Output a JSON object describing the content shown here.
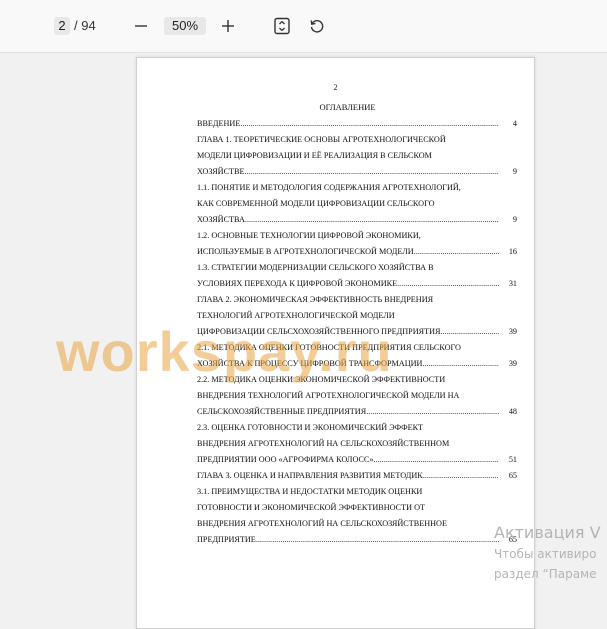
{
  "toolbar": {
    "current_page": "2",
    "total_pages": "/ 94",
    "zoom": "50%",
    "zoom_out_icon": "minus-icon",
    "zoom_in_icon": "plus-icon",
    "fit_icon": "fit-page-icon",
    "rotate_icon": "rotate-icon"
  },
  "document": {
    "page_number": "2",
    "toc_title": "ОГЛАВЛЕНИЕ",
    "toc": [
      {
        "lines": [],
        "last": "ВВЕДЕНИЕ",
        "page": "4"
      },
      {
        "lines": [
          "ГЛАВА 1. ТЕОРЕТИЧЕСКИЕ ОСНОВЫ АГРОТЕХНОЛОГИЧЕСКОЙ",
          "МОДЕЛИ ЦИФРОВИЗАЦИИ И ЕЁ РЕАЛИЗАЦИЯ В СЕЛЬСКОМ"
        ],
        "last": "ХОЗЯЙСТВЕ",
        "page": "9"
      },
      {
        "lines": [
          "1.1. ПОНЯТИЕ И МЕТОДОЛОГИЯ СОДЕРЖАНИЯ АГРОТЕХНОЛОГИЙ,",
          "КАК СОВРЕМЕННОЙ МОДЕЛИ ЦИФРОВИЗАЦИИ СЕЛЬСКОГО"
        ],
        "last": "ХОЗЯЙСТВА",
        "page": "9"
      },
      {
        "lines": [
          "1.2. ОСНОВНЫЕ ТЕХНОЛОГИИ ЦИФРОВОЙ ЭКОНОМИКИ,"
        ],
        "last": "ИСПОЛЬЗУЕМЫЕ В АГРОТЕХНОЛОГИЧЕСКОЙ МОДЕЛИ",
        "page": "16"
      },
      {
        "lines": [
          "1.3. СТРАТЕГИИ МОДЕРНИЗАЦИИ СЕЛЬСКОГО ХОЗЯЙСТВА В"
        ],
        "last": "УСЛОВИЯХ ПЕРЕХОДА К ЦИФРОВОЙ ЭКОНОМИКЕ",
        "page": "31"
      },
      {
        "lines": [
          "ГЛАВА 2. ЭКОНОМИЧЕСКАЯ ЭФФЕКТИВНОСТЬ ВНЕДРЕНИЯ",
          "ТЕХНОЛОГИЙ АГРОТЕХНОЛОГИЧЕСКОЙ МОДЕЛИ"
        ],
        "last": "ЦИФРОВИЗАЦИИ СЕЛЬСХОХОЗЯЙСТВЕННОГО ПРЕДПРИЯТИЯ",
        "page": "39"
      },
      {
        "lines": [
          "2.1. МЕТОДИКА ОЦЕНКИ ГОТОВНОСТИ ПРЕДПРИЯТИЯ СЕЛЬСКОГО"
        ],
        "last": "ХОЗЯЙСТВА К ПРОЦЕССУ ЦИФРОВОЙ ТРАНСФОРМАЦИИ",
        "page": "39"
      },
      {
        "lines": [
          "2.2. МЕТОДИКА ОЦЕНКИ ЭКОНОМИЧЕСКОЙ ЭФФЕКТИВНОСТИ",
          "ВНЕДРЕНИЯ ТЕХНОЛОГИЙ АГРОТЕХНОЛОГИЧЕСКОЙ МОДЕЛИ НА"
        ],
        "last": "СЕЛЬСКОХОЗЯЙСТВЕННЫЕ ПРЕДПРИЯТИЯ",
        "page": "48"
      },
      {
        "lines": [
          "2.3. ОЦЕНКА ГОТОВНОСТИ И ЭКОНОМИЧЕСКИЙ ЭФФЕКТ",
          "ВНЕДРЕНИЯ АГРОТЕХНОЛОГИЙ НА СЕЛЬСКОХОЗЯЙСТВЕННОМ"
        ],
        "last": "ПРЕДПРИЯТИИ ООО «АГРОФИРМА КОЛОСС»",
        "page": "51"
      },
      {
        "lines": [],
        "last": "ГЛАВА 3. ОЦЕНКА И НАПРАВЛЕНИЯ РАЗВИТИЯ МЕТОДИК",
        "page": "65"
      },
      {
        "lines": [
          "3.1. ПРЕИМУЩЕСТВА И НЕДОСТАТКИ МЕТОДИК ОЦЕНКИ",
          "ГОТОВНОСТИ И ЭКОНОМИЧЕСКОЙ ЭФФЕКТИВНОСТИ ОТ",
          "ВНЕДРЕНИЯ АГРОТЕХНОЛОГИЙ НА СЕЛЬСКОХОЗЯЙСТВЕННОЕ"
        ],
        "last": "ПРЕДПРИЯТИЕ",
        "page": "65"
      }
    ],
    "dot_leader": "......................................................................................................................................................................."
  },
  "watermark": {
    "text": "workspay.ru",
    "color": "#e8a442"
  },
  "activation": {
    "title": "Активация V",
    "line1": "Чтобы активиро",
    "line2": "раздел “Параме"
  }
}
